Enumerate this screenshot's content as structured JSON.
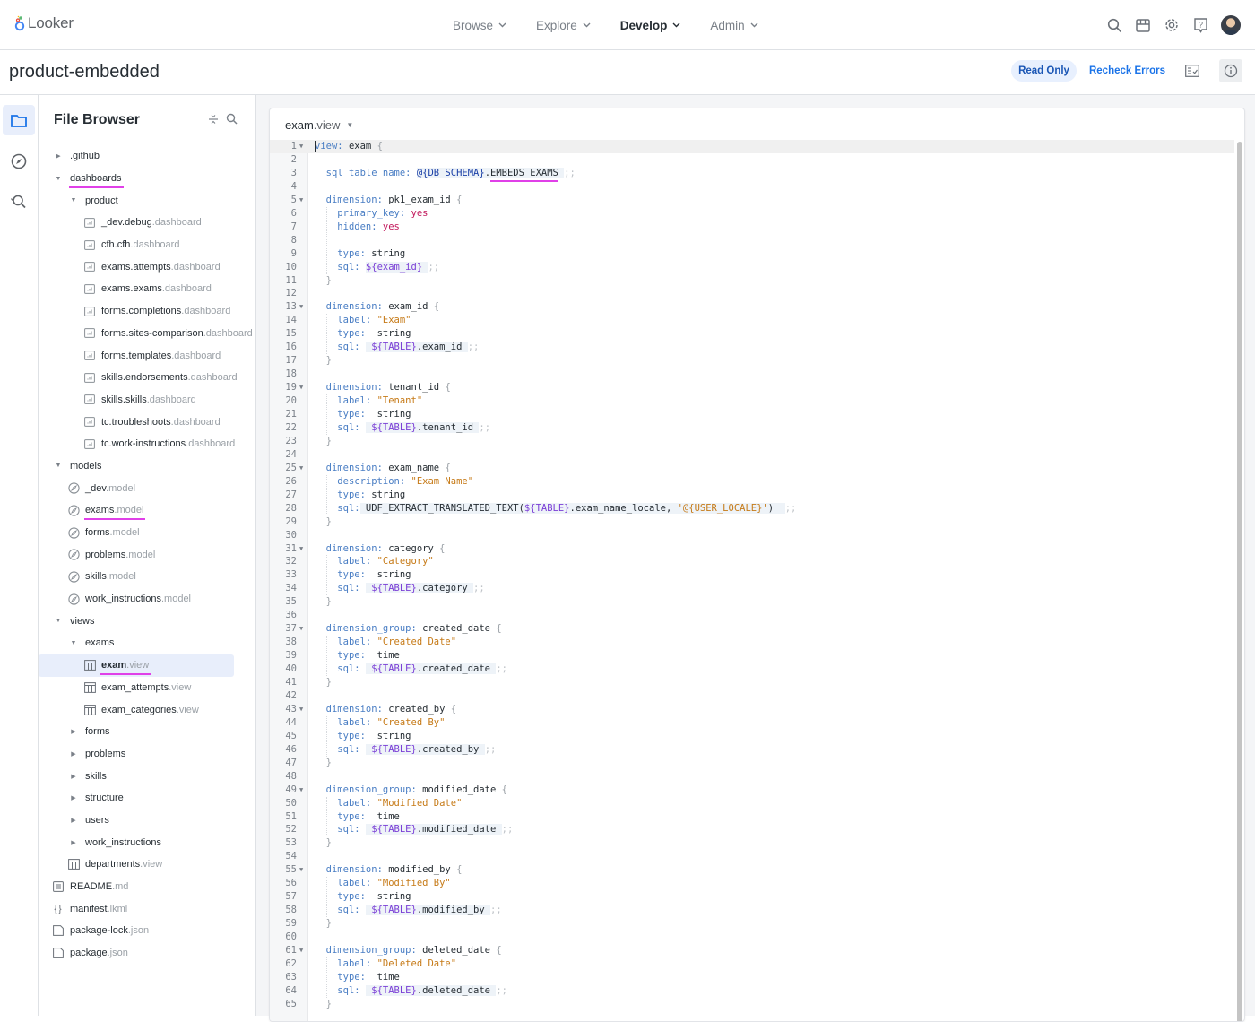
{
  "app": {
    "logo_text": "Looker",
    "nav": [
      {
        "label": "Browse",
        "active": false
      },
      {
        "label": "Explore",
        "active": false
      },
      {
        "label": "Develop",
        "active": true
      },
      {
        "label": "Admin",
        "active": false
      }
    ],
    "top_icons": [
      "search-icon",
      "marketplace-icon",
      "settings-icon",
      "help-icon",
      "user-avatar"
    ]
  },
  "project": {
    "title": "product-embedded",
    "read_only_badge": "Read Only",
    "recheck_label": "Recheck Errors",
    "actions": [
      "validate-icon",
      "info-icon"
    ]
  },
  "rail": [
    "folder-icon",
    "explore-compass-icon",
    "find-replace-icon"
  ],
  "file_browser": {
    "title": "File Browser",
    "tools": [
      "collapse-all-icon",
      "search-icon"
    ],
    "tree": [
      {
        "depth": 0,
        "type": "folder",
        "open": false,
        "name": ".github",
        "ext": ""
      },
      {
        "depth": 0,
        "type": "folder",
        "open": true,
        "name": "dashboards",
        "ext": "",
        "underlined": true
      },
      {
        "depth": 1,
        "type": "folder",
        "open": true,
        "name": "product",
        "ext": ""
      },
      {
        "depth": 2,
        "type": "dashboard",
        "name": "_dev.debug",
        "ext": ".dashboard"
      },
      {
        "depth": 2,
        "type": "dashboard",
        "name": "cfh.cfh",
        "ext": ".dashboard"
      },
      {
        "depth": 2,
        "type": "dashboard",
        "name": "exams.attempts",
        "ext": ".dashboard"
      },
      {
        "depth": 2,
        "type": "dashboard",
        "name": "exams.exams",
        "ext": ".dashboard"
      },
      {
        "depth": 2,
        "type": "dashboard",
        "name": "forms.completions",
        "ext": ".dashboard"
      },
      {
        "depth": 2,
        "type": "dashboard",
        "name": "forms.sites-comparison",
        "ext": ".dashboard"
      },
      {
        "depth": 2,
        "type": "dashboard",
        "name": "forms.templates",
        "ext": ".dashboard"
      },
      {
        "depth": 2,
        "type": "dashboard",
        "name": "skills.endorsements",
        "ext": ".dashboard"
      },
      {
        "depth": 2,
        "type": "dashboard",
        "name": "skills.skills",
        "ext": ".dashboard"
      },
      {
        "depth": 2,
        "type": "dashboard",
        "name": "tc.troubleshoots",
        "ext": ".dashboard"
      },
      {
        "depth": 2,
        "type": "dashboard",
        "name": "tc.work-instructions",
        "ext": ".dashboard"
      },
      {
        "depth": 0,
        "type": "folder",
        "open": true,
        "name": "models",
        "ext": ""
      },
      {
        "depth": 1,
        "type": "model",
        "name": "_dev",
        "ext": ".model"
      },
      {
        "depth": 1,
        "type": "model",
        "name": "exams",
        "ext": ".model",
        "underlined": true
      },
      {
        "depth": 1,
        "type": "model",
        "name": "forms",
        "ext": ".model"
      },
      {
        "depth": 1,
        "type": "model",
        "name": "problems",
        "ext": ".model"
      },
      {
        "depth": 1,
        "type": "model",
        "name": "skills",
        "ext": ".model"
      },
      {
        "depth": 1,
        "type": "model",
        "name": "work_instructions",
        "ext": ".model"
      },
      {
        "depth": 0,
        "type": "folder",
        "open": true,
        "name": "views",
        "ext": ""
      },
      {
        "depth": 1,
        "type": "folder",
        "open": true,
        "name": "exams",
        "ext": ""
      },
      {
        "depth": 2,
        "type": "view",
        "name": "exam",
        "ext": ".view",
        "selected": true,
        "underlined": true
      },
      {
        "depth": 2,
        "type": "view",
        "name": "exam_attempts",
        "ext": ".view"
      },
      {
        "depth": 2,
        "type": "view",
        "name": "exam_categories",
        "ext": ".view"
      },
      {
        "depth": 1,
        "type": "folder",
        "open": false,
        "name": "forms",
        "ext": ""
      },
      {
        "depth": 1,
        "type": "folder",
        "open": false,
        "name": "problems",
        "ext": ""
      },
      {
        "depth": 1,
        "type": "folder",
        "open": false,
        "name": "skills",
        "ext": ""
      },
      {
        "depth": 1,
        "type": "folder",
        "open": false,
        "name": "structure",
        "ext": ""
      },
      {
        "depth": 1,
        "type": "folder",
        "open": false,
        "name": "users",
        "ext": ""
      },
      {
        "depth": 1,
        "type": "folder",
        "open": false,
        "name": "work_instructions",
        "ext": ""
      },
      {
        "depth": 1,
        "type": "view",
        "name": "departments",
        "ext": ".view"
      },
      {
        "depth": 0,
        "type": "doc",
        "name": "README",
        "ext": ".md"
      },
      {
        "depth": 0,
        "type": "manifest",
        "name": "manifest",
        "ext": ".lkml"
      },
      {
        "depth": 0,
        "type": "file",
        "name": "package-lock",
        "ext": ".json"
      },
      {
        "depth": 0,
        "type": "file",
        "name": "package",
        "ext": ".json"
      }
    ]
  },
  "editor": {
    "file_name": "exam",
    "file_ext": ".view",
    "lines": [
      [
        [
          "k",
          "view"
        ],
        [
          "k",
          ": "
        ],
        [
          "p",
          "exam "
        ],
        [
          "br",
          "{"
        ]
      ],
      [],
      [
        [
          "p",
          "  "
        ],
        [
          "k",
          "sql_table_name"
        ],
        [
          "k",
          ": "
        ],
        [
          "bgs",
          "@{DB_SCHEMA}"
        ],
        [
          "bgp",
          "."
        ],
        [
          "bgu",
          "EMBEDS_EXAMS"
        ],
        [
          "bgp",
          " "
        ],
        [
          "semi",
          ";;"
        ]
      ],
      [],
      [
        [
          "p",
          "  "
        ],
        [
          "k",
          "dimension"
        ],
        [
          "k",
          ": "
        ],
        [
          "p",
          "pk1_exam_id "
        ],
        [
          "br",
          "{"
        ]
      ],
      [
        [
          "p",
          "    "
        ],
        [
          "k",
          "primary_key"
        ],
        [
          "k",
          ": "
        ],
        [
          "v",
          "yes"
        ]
      ],
      [
        [
          "p",
          "    "
        ],
        [
          "k",
          "hidden"
        ],
        [
          "k",
          ": "
        ],
        [
          "v",
          "yes"
        ]
      ],
      [],
      [
        [
          "p",
          "    "
        ],
        [
          "k",
          "type"
        ],
        [
          "k",
          ": "
        ],
        [
          "p",
          "string"
        ]
      ],
      [
        [
          "p",
          "    "
        ],
        [
          "k",
          "sql"
        ],
        [
          "k",
          ": "
        ],
        [
          "bgsub",
          "${exam_id}"
        ],
        [
          "bgp",
          " "
        ],
        [
          "semi",
          ";;"
        ]
      ],
      [
        [
          "p",
          "  "
        ],
        [
          "br",
          "}"
        ]
      ],
      [],
      [
        [
          "p",
          "  "
        ],
        [
          "k",
          "dimension"
        ],
        [
          "k",
          ": "
        ],
        [
          "p",
          "exam_id "
        ],
        [
          "br",
          "{"
        ]
      ],
      [
        [
          "p",
          "    "
        ],
        [
          "k",
          "label"
        ],
        [
          "k",
          ": "
        ],
        [
          "s",
          "\"Exam\""
        ]
      ],
      [
        [
          "p",
          "    "
        ],
        [
          "k",
          "type"
        ],
        [
          "k",
          ":  "
        ],
        [
          "p",
          "string"
        ]
      ],
      [
        [
          "p",
          "    "
        ],
        [
          "k",
          "sql"
        ],
        [
          "k",
          ": "
        ],
        [
          "bgp",
          " "
        ],
        [
          "bgsub",
          "${TABLE}"
        ],
        [
          "bgp",
          ".exam_id "
        ],
        [
          "semi",
          ";;"
        ]
      ],
      [
        [
          "p",
          "  "
        ],
        [
          "br",
          "}"
        ]
      ],
      [],
      [
        [
          "p",
          "  "
        ],
        [
          "k",
          "dimension"
        ],
        [
          "k",
          ": "
        ],
        [
          "p",
          "tenant_id "
        ],
        [
          "br",
          "{"
        ]
      ],
      [
        [
          "p",
          "    "
        ],
        [
          "k",
          "label"
        ],
        [
          "k",
          ": "
        ],
        [
          "s",
          "\"Tenant\""
        ]
      ],
      [
        [
          "p",
          "    "
        ],
        [
          "k",
          "type"
        ],
        [
          "k",
          ":  "
        ],
        [
          "p",
          "string"
        ]
      ],
      [
        [
          "p",
          "    "
        ],
        [
          "k",
          "sql"
        ],
        [
          "k",
          ": "
        ],
        [
          "bgp",
          " "
        ],
        [
          "bgsub",
          "${TABLE}"
        ],
        [
          "bgp",
          ".tenant_id "
        ],
        [
          "semi",
          ";;"
        ]
      ],
      [
        [
          "p",
          "  "
        ],
        [
          "br",
          "}"
        ]
      ],
      [],
      [
        [
          "p",
          "  "
        ],
        [
          "k",
          "dimension"
        ],
        [
          "k",
          ": "
        ],
        [
          "p",
          "exam_name "
        ],
        [
          "br",
          "{"
        ]
      ],
      [
        [
          "p",
          "    "
        ],
        [
          "k",
          "description"
        ],
        [
          "k",
          ": "
        ],
        [
          "s",
          "\"Exam Name\""
        ]
      ],
      [
        [
          "p",
          "    "
        ],
        [
          "k",
          "type"
        ],
        [
          "k",
          ": "
        ],
        [
          "p",
          "string"
        ]
      ],
      [
        [
          "p",
          "    "
        ],
        [
          "k",
          "sql"
        ],
        [
          "k",
          ":"
        ],
        [
          "bgp",
          " UDF_EXTRACT_TRANSLATED_TEXT("
        ],
        [
          "bgsub",
          "${TABLE}"
        ],
        [
          "bgp",
          ".exam_name_locale, "
        ],
        [
          "bgstr",
          "'@{USER_LOCALE}'"
        ],
        [
          "bgp",
          ")  "
        ],
        [
          "semi",
          ";;"
        ]
      ],
      [
        [
          "p",
          "  "
        ],
        [
          "br",
          "}"
        ]
      ],
      [],
      [
        [
          "p",
          "  "
        ],
        [
          "k",
          "dimension"
        ],
        [
          "k",
          ": "
        ],
        [
          "p",
          "category "
        ],
        [
          "br",
          "{"
        ]
      ],
      [
        [
          "p",
          "    "
        ],
        [
          "k",
          "label"
        ],
        [
          "k",
          ": "
        ],
        [
          "s",
          "\"Category\""
        ]
      ],
      [
        [
          "p",
          "    "
        ],
        [
          "k",
          "type"
        ],
        [
          "k",
          ":  "
        ],
        [
          "p",
          "string"
        ]
      ],
      [
        [
          "p",
          "    "
        ],
        [
          "k",
          "sql"
        ],
        [
          "k",
          ": "
        ],
        [
          "bgp",
          " "
        ],
        [
          "bgsub",
          "${TABLE}"
        ],
        [
          "bgp",
          ".category "
        ],
        [
          "semi",
          ";;"
        ]
      ],
      [
        [
          "p",
          "  "
        ],
        [
          "br",
          "}"
        ]
      ],
      [],
      [
        [
          "p",
          "  "
        ],
        [
          "k",
          "dimension_group"
        ],
        [
          "k",
          ": "
        ],
        [
          "p",
          "created_date "
        ],
        [
          "br",
          "{"
        ]
      ],
      [
        [
          "p",
          "    "
        ],
        [
          "k",
          "label"
        ],
        [
          "k",
          ": "
        ],
        [
          "s",
          "\"Created Date\""
        ]
      ],
      [
        [
          "p",
          "    "
        ],
        [
          "k",
          "type"
        ],
        [
          "k",
          ":  "
        ],
        [
          "p",
          "time"
        ]
      ],
      [
        [
          "p",
          "    "
        ],
        [
          "k",
          "sql"
        ],
        [
          "k",
          ": "
        ],
        [
          "bgp",
          " "
        ],
        [
          "bgsub",
          "${TABLE}"
        ],
        [
          "bgp",
          ".created_date "
        ],
        [
          "semi",
          ";;"
        ]
      ],
      [
        [
          "p",
          "  "
        ],
        [
          "br",
          "}"
        ]
      ],
      [],
      [
        [
          "p",
          "  "
        ],
        [
          "k",
          "dimension"
        ],
        [
          "k",
          ": "
        ],
        [
          "p",
          "created_by "
        ],
        [
          "br",
          "{"
        ]
      ],
      [
        [
          "p",
          "    "
        ],
        [
          "k",
          "label"
        ],
        [
          "k",
          ": "
        ],
        [
          "s",
          "\"Created By\""
        ]
      ],
      [
        [
          "p",
          "    "
        ],
        [
          "k",
          "type"
        ],
        [
          "k",
          ":  "
        ],
        [
          "p",
          "string"
        ]
      ],
      [
        [
          "p",
          "    "
        ],
        [
          "k",
          "sql"
        ],
        [
          "k",
          ": "
        ],
        [
          "bgp",
          " "
        ],
        [
          "bgsub",
          "${TABLE}"
        ],
        [
          "bgp",
          ".created_by "
        ],
        [
          "semi",
          ";;"
        ]
      ],
      [
        [
          "p",
          "  "
        ],
        [
          "br",
          "}"
        ]
      ],
      [],
      [
        [
          "p",
          "  "
        ],
        [
          "k",
          "dimension_group"
        ],
        [
          "k",
          ": "
        ],
        [
          "p",
          "modified_date "
        ],
        [
          "br",
          "{"
        ]
      ],
      [
        [
          "p",
          "    "
        ],
        [
          "k",
          "label"
        ],
        [
          "k",
          ": "
        ],
        [
          "s",
          "\"Modified Date\""
        ]
      ],
      [
        [
          "p",
          "    "
        ],
        [
          "k",
          "type"
        ],
        [
          "k",
          ":  "
        ],
        [
          "p",
          "time"
        ]
      ],
      [
        [
          "p",
          "    "
        ],
        [
          "k",
          "sql"
        ],
        [
          "k",
          ": "
        ],
        [
          "bgp",
          " "
        ],
        [
          "bgsub",
          "${TABLE}"
        ],
        [
          "bgp",
          ".modified_date "
        ],
        [
          "semi",
          ";;"
        ]
      ],
      [
        [
          "p",
          "  "
        ],
        [
          "br",
          "}"
        ]
      ],
      [],
      [
        [
          "p",
          "  "
        ],
        [
          "k",
          "dimension"
        ],
        [
          "k",
          ": "
        ],
        [
          "p",
          "modified_by "
        ],
        [
          "br",
          "{"
        ]
      ],
      [
        [
          "p",
          "    "
        ],
        [
          "k",
          "label"
        ],
        [
          "k",
          ": "
        ],
        [
          "s",
          "\"Modified By\""
        ]
      ],
      [
        [
          "p",
          "    "
        ],
        [
          "k",
          "type"
        ],
        [
          "k",
          ":  "
        ],
        [
          "p",
          "string"
        ]
      ],
      [
        [
          "p",
          "    "
        ],
        [
          "k",
          "sql"
        ],
        [
          "k",
          ": "
        ],
        [
          "bgp",
          " "
        ],
        [
          "bgsub",
          "${TABLE}"
        ],
        [
          "bgp",
          ".modified_by "
        ],
        [
          "semi",
          ";;"
        ]
      ],
      [
        [
          "p",
          "  "
        ],
        [
          "br",
          "}"
        ]
      ],
      [],
      [
        [
          "p",
          "  "
        ],
        [
          "k",
          "dimension_group"
        ],
        [
          "k",
          ": "
        ],
        [
          "p",
          "deleted_date "
        ],
        [
          "br",
          "{"
        ]
      ],
      [
        [
          "p",
          "    "
        ],
        [
          "k",
          "label"
        ],
        [
          "k",
          ": "
        ],
        [
          "s",
          "\"Deleted Date\""
        ]
      ],
      [
        [
          "p",
          "    "
        ],
        [
          "k",
          "type"
        ],
        [
          "k",
          ":  "
        ],
        [
          "p",
          "time"
        ]
      ],
      [
        [
          "p",
          "    "
        ],
        [
          "k",
          "sql"
        ],
        [
          "k",
          ": "
        ],
        [
          "bgp",
          " "
        ],
        [
          "bgsub",
          "${TABLE}"
        ],
        [
          "bgp",
          ".deleted_date "
        ],
        [
          "semi",
          ";;"
        ]
      ],
      [
        [
          "p",
          "  "
        ],
        [
          "br",
          "}"
        ]
      ]
    ],
    "foldable_lines": [
      1,
      5,
      13,
      19,
      25,
      31,
      37,
      43,
      49,
      55,
      61
    ]
  },
  "colors": {
    "accent": "#1a73e8",
    "annotation_underline": "#e040e8",
    "selected_row": "#e8eefb"
  }
}
